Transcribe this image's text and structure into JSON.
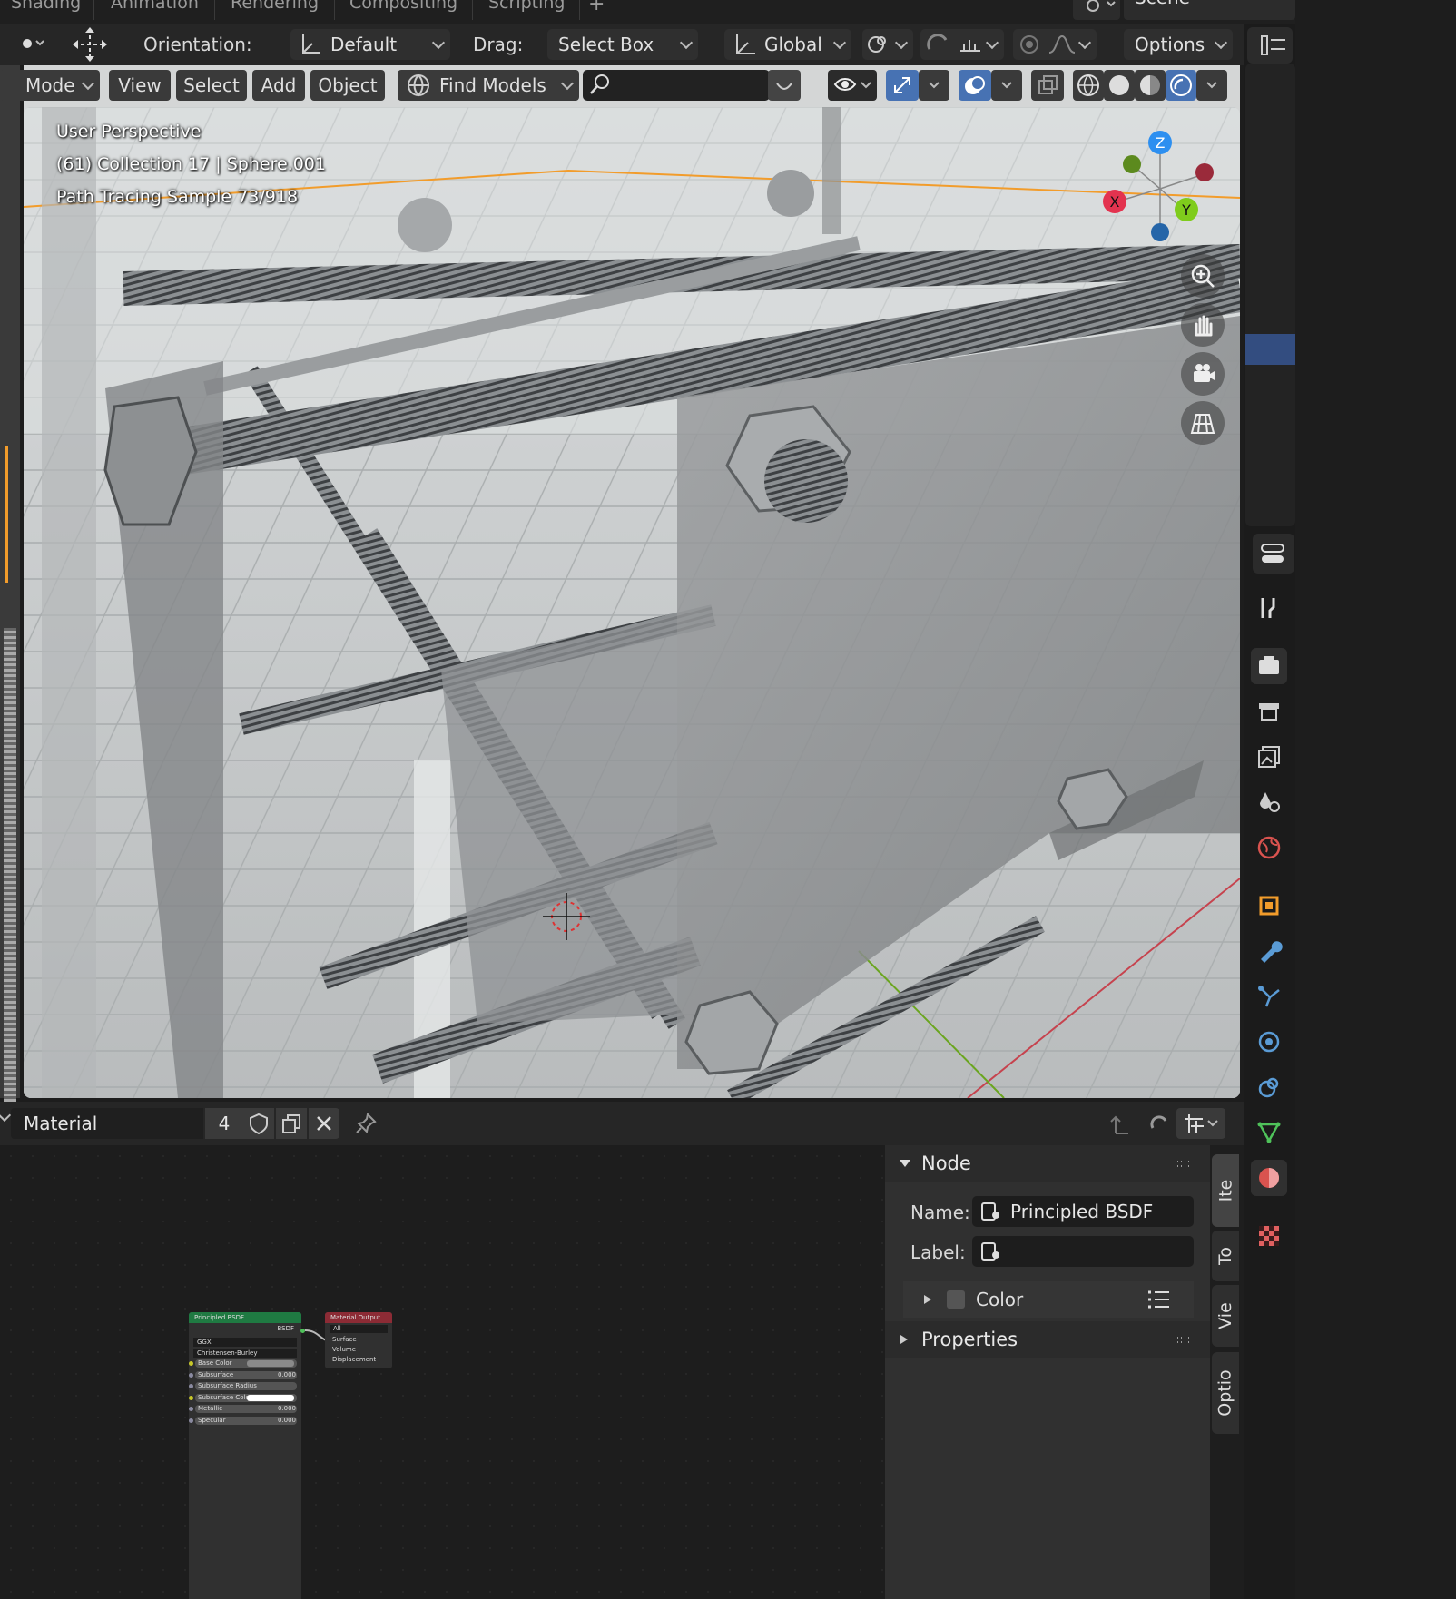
{
  "workspace_tabs": [
    "Shading",
    "Animation",
    "Rendering",
    "Compositing",
    "Scripting",
    "+"
  ],
  "scene": {
    "name": "Scene"
  },
  "tool_header": {
    "orientation_label": "Orientation:",
    "orientation_value": "Default",
    "drag_label": "Drag:",
    "drag_value": "Select Box",
    "transform_orientation": "Global",
    "options_label": "Options"
  },
  "viewport_header": {
    "mode_label": "Mode",
    "menus": [
      "View",
      "Select",
      "Add",
      "Object"
    ],
    "find_models": "Find Models",
    "search_value": ""
  },
  "viewport_overlay": {
    "perspective": "User Perspective",
    "collection": "(61) Collection 17 | Sphere.001",
    "render_status": "Path Tracing Sample 73/918"
  },
  "gizmo": {
    "x": "X",
    "y": "Y",
    "z": "Z"
  },
  "node_editor_header": {
    "material_name": "Material",
    "user_count": "4"
  },
  "node_panel": {
    "section_node": "Node",
    "name_label": "Name:",
    "name_value": "Principled BSDF",
    "label_label": "Label:",
    "label_value": "",
    "color_label": "Color",
    "section_properties": "Properties"
  },
  "sidebar_tabs": [
    "Ite",
    "To",
    "Vie",
    "Optio"
  ],
  "nodes": {
    "bsdf_title": "Principled BSDF",
    "bsdf_output": "BSDF",
    "bsdf_dist": "GGX",
    "bsdf_sss": "Christensen-Burley",
    "bsdf_rows": [
      {
        "name": "Base Color",
        "value": ""
      },
      {
        "name": "Subsurface",
        "value": "0.000"
      },
      {
        "name": "Subsurface Radius",
        "value": ""
      },
      {
        "name": "Subsurface Colo",
        "value": ""
      },
      {
        "name": "Metallic",
        "value": "0.000"
      },
      {
        "name": "Specular",
        "value": "0.000"
      }
    ],
    "output_title": "Material Output",
    "output_target": "All",
    "output_inputs": [
      "Surface",
      "Volume",
      "Displacement"
    ]
  },
  "colors": {
    "axis_x": "#e3334f",
    "axis_y": "#7fcc1c",
    "axis_z": "#2d8ff0",
    "active_blue": "#4772b3",
    "selection_orange": "#f29c2b"
  }
}
